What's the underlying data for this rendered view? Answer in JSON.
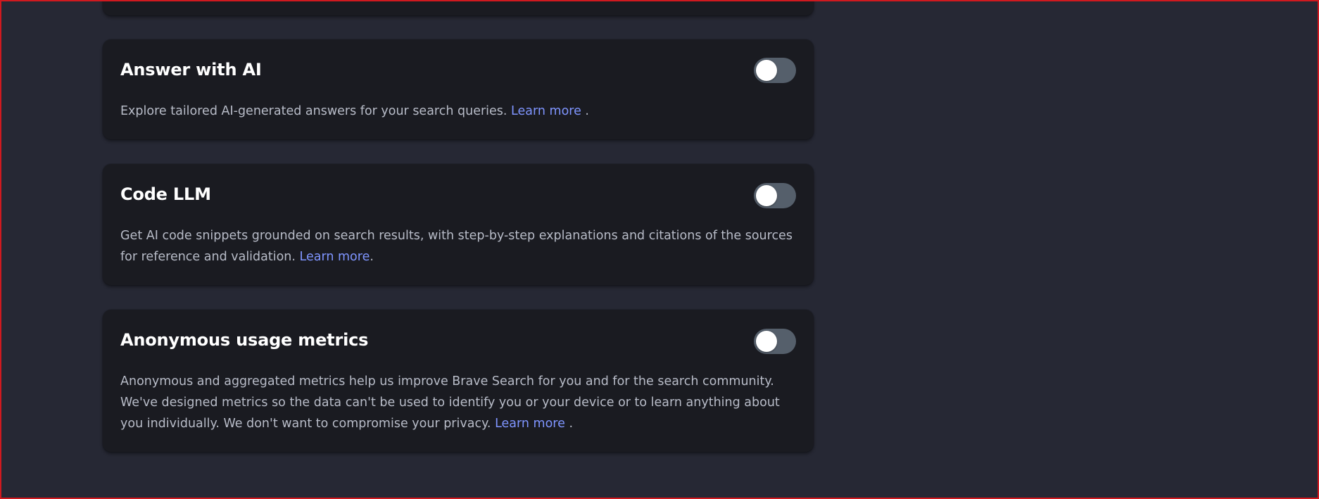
{
  "settings": [
    {
      "title": "Answer with AI",
      "description": "Explore tailored AI-generated answers for your search queries. ",
      "link_label": "Learn more",
      "trailing": " .",
      "enabled": false
    },
    {
      "title": "Code LLM",
      "description": "Get AI code snippets grounded on search results, with step-by-step explanations and citations of the sources for reference and validation. ",
      "link_label": "Learn more",
      "trailing": ".",
      "enabled": false
    },
    {
      "title": "Anonymous usage metrics",
      "description": "Anonymous and aggregated metrics help us improve Brave Search for you and for the search community. We've designed metrics so the data can't be used to identify you or your device or to learn anything about you individually. We don't want to compromise your privacy. ",
      "link_label": "Learn more",
      "trailing": " .",
      "enabled": false
    }
  ],
  "colors": {
    "page_background": "#262834",
    "card_background": "#1a1b21",
    "title_text": "#ffffff",
    "body_text": "#b8bcc8",
    "link": "#7f95ff",
    "toggle_off": "#555f6b",
    "frame_border": "#d0191f"
  }
}
